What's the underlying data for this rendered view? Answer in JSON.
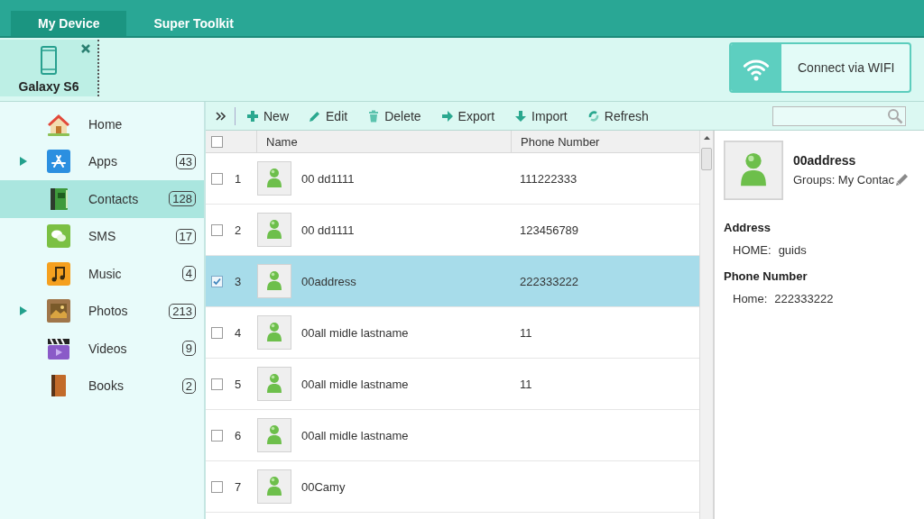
{
  "tabs": [
    {
      "label": "My Device",
      "selected": true
    },
    {
      "label": "Super Toolkit",
      "selected": false
    }
  ],
  "devices": [
    {
      "name": "Galaxy S6"
    }
  ],
  "connect_button": {
    "label": "Connect via WIFI"
  },
  "sidebar": {
    "items": [
      {
        "kind": "home",
        "label": "Home",
        "expandable": false,
        "selected": false
      },
      {
        "kind": "apps",
        "label": "Apps",
        "count": "43",
        "expandable": true,
        "selected": false
      },
      {
        "kind": "contacts",
        "label": "Contacts",
        "count": "128",
        "expandable": false,
        "selected": true
      },
      {
        "kind": "sms",
        "label": "SMS",
        "count": "17",
        "expandable": false,
        "selected": false
      },
      {
        "kind": "music",
        "label": "Music",
        "count": "4",
        "expandable": false,
        "selected": false
      },
      {
        "kind": "photos",
        "label": "Photos",
        "count": "213",
        "expandable": true,
        "selected": false
      },
      {
        "kind": "videos",
        "label": "Videos",
        "count": "9",
        "expandable": false,
        "selected": false
      },
      {
        "kind": "books",
        "label": "Books",
        "count": "2",
        "expandable": false,
        "selected": false
      }
    ]
  },
  "toolbar": {
    "buttons": [
      {
        "kind": "new",
        "label": "New"
      },
      {
        "kind": "edit",
        "label": "Edit"
      },
      {
        "kind": "delete",
        "label": "Delete"
      },
      {
        "kind": "export",
        "label": "Export"
      },
      {
        "kind": "import",
        "label": "Import"
      },
      {
        "kind": "refresh",
        "label": "Refresh"
      }
    ]
  },
  "table": {
    "header_checked": false,
    "columns": [
      "Name",
      "Phone Number"
    ],
    "rows": [
      {
        "number": "1",
        "name": "00 dd1111",
        "phone": "111222333",
        "checked": false,
        "selected": false
      },
      {
        "number": "2",
        "name": "00 dd1111",
        "phone": "123456789",
        "checked": false,
        "selected": false
      },
      {
        "number": "3",
        "name": "00address",
        "phone": "222333222",
        "checked": true,
        "selected": true
      },
      {
        "number": "4",
        "name": "00all midle lastname",
        "phone": "11",
        "checked": false,
        "selected": false
      },
      {
        "number": "5",
        "name": "00all midle lastname",
        "phone": "11",
        "checked": false,
        "selected": false
      },
      {
        "number": "6",
        "name": "00all midle lastname",
        "checked": false,
        "selected": false
      },
      {
        "number": "7",
        "name": "00Camy",
        "checked": false,
        "selected": false
      }
    ]
  },
  "detail": {
    "name": "00address",
    "groups": "Groups: My Contac",
    "sections": [
      {
        "heading": "Address",
        "fields": [
          {
            "label": "HOME:",
            "value": "guids"
          }
        ]
      },
      {
        "heading": "Phone Number",
        "fields": [
          {
            "label": "Home:",
            "value": "222333222"
          }
        ]
      }
    ]
  }
}
